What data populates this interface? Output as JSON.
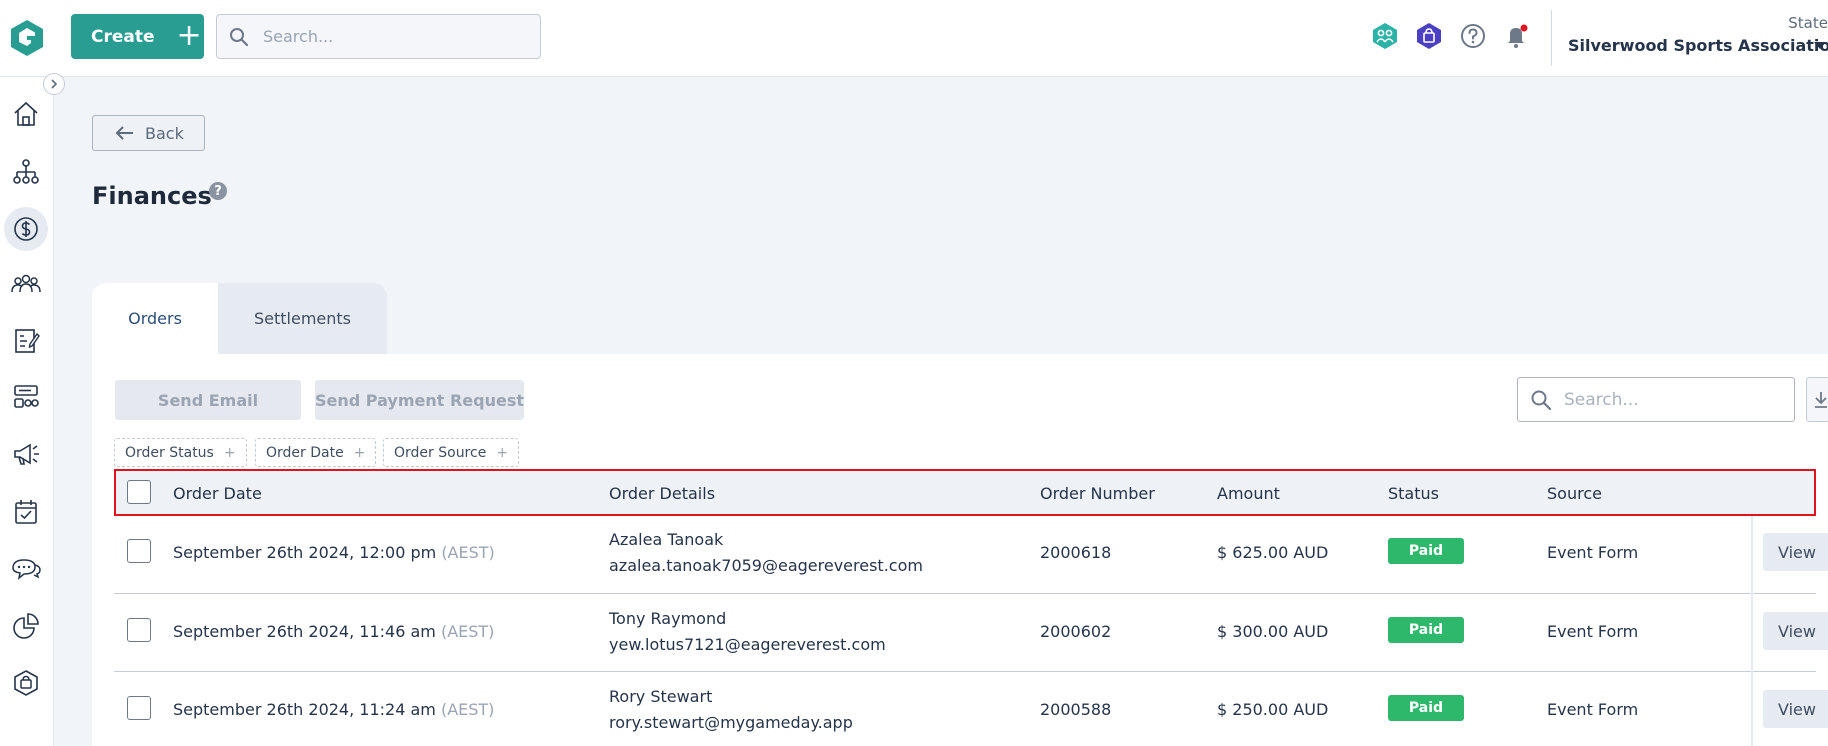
{
  "header": {
    "create_label": "Create",
    "search_placeholder": "Search...",
    "icons": [
      "teams-icon",
      "shop-bag-icon",
      "help-icon",
      "bell-icon"
    ],
    "org_state": "State",
    "org_name": "Silverwood Sports Association"
  },
  "sidebar": {
    "items": [
      {
        "name": "home-icon"
      },
      {
        "name": "org-chart-icon"
      },
      {
        "name": "dollar-icon",
        "active": true
      },
      {
        "name": "people-icon"
      },
      {
        "name": "form-icon"
      },
      {
        "name": "competitions-icon"
      },
      {
        "name": "megaphone-icon"
      },
      {
        "name": "calendar-icon"
      },
      {
        "name": "chat-icon"
      },
      {
        "name": "pie-chart-icon"
      },
      {
        "name": "shop-icon"
      }
    ]
  },
  "page": {
    "back_label": "Back",
    "title": "Finances",
    "help_glyph": "?",
    "tabs": [
      {
        "label": "Orders",
        "active": true
      },
      {
        "label": "Settlements",
        "active": false
      }
    ]
  },
  "toolbar": {
    "send_email": "Send Email",
    "send_payment_request": "Send Payment Request",
    "search_placeholder": "Search..."
  },
  "filters": [
    "Order Status",
    "Order Date",
    "Order Source"
  ],
  "table": {
    "columns": [
      "Order Date",
      "Order Details",
      "Order Number",
      "Amount",
      "Status",
      "Source"
    ],
    "rows": [
      {
        "date": "September 26th 2024, 12:00 pm",
        "tz": "(AEST)",
        "name": "Azalea Tanoak",
        "email": "azalea.tanoak7059@eagereverest.com",
        "number": "2000618",
        "amount": "$ 625.00 AUD",
        "status": "Paid",
        "source": "Event Form",
        "action": "View"
      },
      {
        "date": "September 26th 2024, 11:46 am",
        "tz": "(AEST)",
        "name": "Tony Raymond",
        "email": "yew.lotus7121@eagereverest.com",
        "number": "2000602",
        "amount": "$ 300.00 AUD",
        "status": "Paid",
        "source": "Event Form",
        "action": "View"
      },
      {
        "date": "September 26th 2024, 11:24 am",
        "tz": "(AEST)",
        "name": "Rory Stewart",
        "email": "rory.stewart@mygameday.app",
        "number": "2000588",
        "amount": "$ 250.00 AUD",
        "status": "Paid",
        "source": "Event Form",
        "action": "View"
      }
    ]
  },
  "colors": {
    "brand": "#2a9d93",
    "paid": "#2eb86b",
    "highlight": "#e0141e"
  }
}
